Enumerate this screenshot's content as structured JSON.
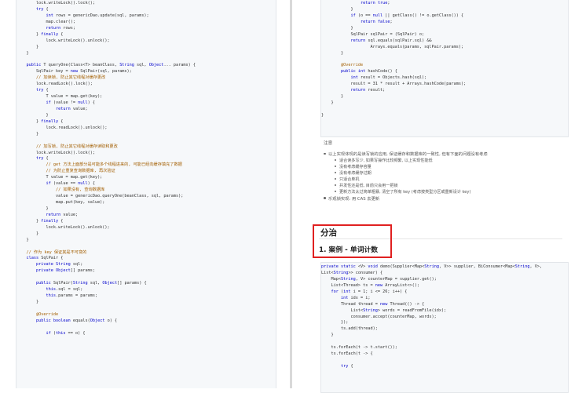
{
  "left_code": [
    [
      [
        "tx",
        "        lock.writeLock().lock();"
      ]
    ],
    [
      [
        "tx",
        "        "
      ],
      [
        "kw",
        "try"
      ],
      [
        "tx",
        " {"
      ]
    ],
    [
      [
        "tx",
        "            "
      ],
      [
        "kw",
        "int"
      ],
      [
        "tx",
        " rows = genericDao.update(sql, params);"
      ]
    ],
    [
      [
        "tx",
        "            map.clear();"
      ]
    ],
    [
      [
        "tx",
        "            "
      ],
      [
        "kw",
        "return"
      ],
      [
        "tx",
        " rows;"
      ]
    ],
    [
      [
        "tx",
        "        } "
      ],
      [
        "kw",
        "finally"
      ],
      [
        "tx",
        " {"
      ]
    ],
    [
      [
        "tx",
        "            lock.writeLock().unlock();"
      ]
    ],
    [
      [
        "tx",
        "        }"
      ]
    ],
    [
      [
        "tx",
        "    }"
      ]
    ],
    [
      [
        "tx",
        ""
      ]
    ],
    [
      [
        "kw",
        "    public"
      ],
      [
        "tx",
        " T queryOne(Class<T> beanClass, "
      ],
      [
        "kw",
        "String"
      ],
      [
        "tx",
        " sql, "
      ],
      [
        "kw",
        "Object"
      ],
      [
        "tx",
        "... params) {"
      ]
    ],
    [
      [
        "tx",
        "        SqlPair key = "
      ],
      [
        "kw",
        "new"
      ],
      [
        "tx",
        " SqlPair(sql, params);"
      ]
    ],
    [
      [
        "cm",
        "        // 加读锁, 防止其它线程对缓存更改"
      ]
    ],
    [
      [
        "tx",
        "        lock.readLock().lock();"
      ]
    ],
    [
      [
        "tx",
        "        "
      ],
      [
        "kw",
        "try"
      ],
      [
        "tx",
        " {"
      ]
    ],
    [
      [
        "tx",
        "            T value = map.get(key);"
      ]
    ],
    [
      [
        "tx",
        "            "
      ],
      [
        "kw",
        "if"
      ],
      [
        "tx",
        " (value != "
      ],
      [
        "kw",
        "null"
      ],
      [
        "tx",
        ") {"
      ]
    ],
    [
      [
        "tx",
        "                "
      ],
      [
        "kw",
        "return"
      ],
      [
        "tx",
        " value;"
      ]
    ],
    [
      [
        "tx",
        "            }"
      ]
    ],
    [
      [
        "tx",
        "        } "
      ],
      [
        "kw",
        "finally"
      ],
      [
        "tx",
        " {"
      ]
    ],
    [
      [
        "tx",
        "            lock.readLock().unlock();"
      ]
    ],
    [
      [
        "tx",
        "        }"
      ]
    ],
    [
      [
        "tx",
        ""
      ]
    ],
    [
      [
        "cm",
        "        // 加写锁, 防止其它线程对缓存读取和更改"
      ]
    ],
    [
      [
        "tx",
        "        lock.writeLock().lock();"
      ]
    ],
    [
      [
        "tx",
        "        "
      ],
      [
        "kw",
        "try"
      ],
      [
        "tx",
        " {"
      ]
    ],
    [
      [
        "cm",
        "            // get 方法上面部分是可能多个线程进来的, 可能已经向缓存填充了数据"
      ]
    ],
    [
      [
        "cm",
        "            // 为防止重复查询数据库, 再次验证"
      ]
    ],
    [
      [
        "tx",
        "            T value = map.get(key);"
      ]
    ],
    [
      [
        "tx",
        "            "
      ],
      [
        "kw",
        "if"
      ],
      [
        "tx",
        " (value == "
      ],
      [
        "kw",
        "null"
      ],
      [
        "tx",
        ") {"
      ]
    ],
    [
      [
        "cm",
        "                // 如果没有, 查询数据库"
      ]
    ],
    [
      [
        "tx",
        "                value = genericDao.queryOne(beanClass, sql, params);"
      ]
    ],
    [
      [
        "tx",
        "                map.put(key, value);"
      ]
    ],
    [
      [
        "tx",
        "            }"
      ]
    ],
    [
      [
        "tx",
        "            "
      ],
      [
        "kw",
        "return"
      ],
      [
        "tx",
        " value;"
      ]
    ],
    [
      [
        "tx",
        "        } "
      ],
      [
        "kw",
        "finally"
      ],
      [
        "tx",
        " {"
      ]
    ],
    [
      [
        "tx",
        "            lock.writeLock().unlock();"
      ]
    ],
    [
      [
        "tx",
        "        }"
      ]
    ],
    [
      [
        "tx",
        "    }"
      ]
    ],
    [
      [
        "tx",
        ""
      ]
    ],
    [
      [
        "cm",
        "    // 作为 key 保证其是不可变的"
      ]
    ],
    [
      [
        "kw",
        "    class"
      ],
      [
        "tx",
        " SqlPair {"
      ]
    ],
    [
      [
        "kw",
        "        private"
      ],
      [
        "tx",
        " "
      ],
      [
        "kw",
        "String"
      ],
      [
        "tx",
        " sql;"
      ]
    ],
    [
      [
        "kw",
        "        private"
      ],
      [
        "tx",
        " "
      ],
      [
        "kw",
        "Object"
      ],
      [
        "tx",
        "[] params;"
      ]
    ],
    [
      [
        "tx",
        ""
      ]
    ],
    [
      [
        "kw",
        "        public"
      ],
      [
        "tx",
        " SqlPair("
      ],
      [
        "kw",
        "String"
      ],
      [
        "tx",
        " sql, "
      ],
      [
        "kw",
        "Object"
      ],
      [
        "tx",
        "[] params) {"
      ]
    ],
    [
      [
        "kw",
        "            this"
      ],
      [
        "tx",
        ".sql = sql;"
      ]
    ],
    [
      [
        "kw",
        "            this"
      ],
      [
        "tx",
        ".params = params;"
      ]
    ],
    [
      [
        "tx",
        "        }"
      ]
    ],
    [
      [
        "tx",
        ""
      ]
    ],
    [
      [
        "cm",
        "        @Override"
      ]
    ],
    [
      [
        "kw",
        "        public boolean"
      ],
      [
        "tx",
        " equals("
      ],
      [
        "kw",
        "Object"
      ],
      [
        "tx",
        " o) {"
      ]
    ],
    [
      [
        "tx",
        ""
      ]
    ],
    [
      [
        "tx",
        "            "
      ],
      [
        "kw",
        "if"
      ],
      [
        "tx",
        " ("
      ],
      [
        "kw",
        "this"
      ],
      [
        "tx",
        " == o) {"
      ]
    ]
  ],
  "right_code_top": [
    [
      [
        "tx",
        "                "
      ],
      [
        "kw",
        "return true"
      ],
      [
        "tx",
        ";"
      ]
    ],
    [
      [
        "tx",
        "            }"
      ]
    ],
    [
      [
        "tx",
        "            "
      ],
      [
        "kw",
        "if"
      ],
      [
        "tx",
        " (o == "
      ],
      [
        "kw",
        "null"
      ],
      [
        "tx",
        " || getClass() != o.getClass()) {"
      ]
    ],
    [
      [
        "tx",
        "                "
      ],
      [
        "kw",
        "return false"
      ],
      [
        "tx",
        ";"
      ]
    ],
    [
      [
        "tx",
        "            }"
      ]
    ],
    [
      [
        "tx",
        "            SqlPair sqlPair = (SqlPair) o;"
      ]
    ],
    [
      [
        "tx",
        "            "
      ],
      [
        "kw",
        "return"
      ],
      [
        "tx",
        " sql.equals(sqlPair.sql) &&"
      ]
    ],
    [
      [
        "tx",
        "                    Arrays.equals(params, sqlPair.params);"
      ]
    ],
    [
      [
        "tx",
        "        }"
      ]
    ],
    [
      [
        "tx",
        ""
      ]
    ],
    [
      [
        "cm",
        "        @Override"
      ]
    ],
    [
      [
        "kw",
        "        public int"
      ],
      [
        "tx",
        " hashCode() {"
      ]
    ],
    [
      [
        "tx",
        "            "
      ],
      [
        "kw",
        "int"
      ],
      [
        "tx",
        " result = Objects.hash(sql);"
      ]
    ],
    [
      [
        "tx",
        "            result = 31 * result + Arrays.hashCode(params);"
      ]
    ],
    [
      [
        "tx",
        "            "
      ],
      [
        "kw",
        "return"
      ],
      [
        "tx",
        " result;"
      ]
    ],
    [
      [
        "tx",
        "        }"
      ]
    ],
    [
      [
        "tx",
        "    }"
      ]
    ],
    [
      [
        "tx",
        ""
      ]
    ],
    [
      [
        "tx",
        "}"
      ]
    ],
    [
      [
        "tx",
        ""
      ]
    ]
  ],
  "notes": {
    "title": "注意",
    "items": [
      {
        "level": 1,
        "text": "以上实现体现的是读写锁的应用, 保证缓存和数据库的一致性, 但有下面的问题没有考虑"
      },
      {
        "level": 2,
        "text": "适合读多写少, 如果写操作比较频繁, 以上实现性能低"
      },
      {
        "level": 2,
        "text": "没有考虑缓存容量"
      },
      {
        "level": 2,
        "text": "没有考虑缓存过期"
      },
      {
        "level": 2,
        "text": "只适合单机"
      },
      {
        "level": 2,
        "text": "并发性还是低, 目前只会用一把锁"
      },
      {
        "level": 2,
        "text": "更新方法太过简单粗暴, 清空了所有 key (考虑按类型分区或重新设计 key)"
      },
      {
        "level": 1,
        "text": "乐观锁实现: 用 CAS 去更新"
      }
    ]
  },
  "section": {
    "heading": "分治",
    "subheading": "1. 案例 - 单词计数"
  },
  "right_code_bottom": [
    [
      [
        "kw",
        "private static"
      ],
      [
        "tx",
        " <V> "
      ],
      [
        "kw",
        "void"
      ],
      [
        "tx",
        " demo(Supplier<Map<"
      ],
      [
        "kw",
        "String"
      ],
      [
        "tx",
        ", V>> supplier, BiConsumer<Map<"
      ],
      [
        "kw",
        "String"
      ],
      [
        "tx",
        ", V>,"
      ]
    ],
    [
      [
        "tx",
        "List<"
      ],
      [
        "kw",
        "String"
      ],
      [
        "tx",
        ">> consumer) {"
      ]
    ],
    [
      [
        "tx",
        "    Map<"
      ],
      [
        "kw",
        "String"
      ],
      [
        "tx",
        ", V> counterMap = supplier.get();"
      ]
    ],
    [
      [
        "tx",
        "    List<Thread> ts = "
      ],
      [
        "kw",
        "new"
      ],
      [
        "tx",
        " ArrayList<>();"
      ]
    ],
    [
      [
        "tx",
        "    "
      ],
      [
        "kw",
        "for"
      ],
      [
        "tx",
        " ("
      ],
      [
        "kw",
        "int"
      ],
      [
        "tx",
        " i = 1; i <= 26; i++) {"
      ]
    ],
    [
      [
        "tx",
        "        "
      ],
      [
        "kw",
        "int"
      ],
      [
        "tx",
        " idx = i;"
      ]
    ],
    [
      [
        "tx",
        "        Thread thread = "
      ],
      [
        "kw",
        "new"
      ],
      [
        "tx",
        " Thread(() -> {"
      ]
    ],
    [
      [
        "tx",
        "            List<"
      ],
      [
        "kw",
        "String"
      ],
      [
        "tx",
        "> words = readFromFile(idx);"
      ]
    ],
    [
      [
        "tx",
        "            consumer.accept(counterMap, words);"
      ]
    ],
    [
      [
        "tx",
        "        });"
      ]
    ],
    [
      [
        "tx",
        "        ts.add(thread);"
      ]
    ],
    [
      [
        "tx",
        "    }"
      ]
    ],
    [
      [
        "tx",
        ""
      ]
    ],
    [
      [
        "tx",
        "    ts.forEach(t -> t.start());"
      ]
    ],
    [
      [
        "tx",
        "    ts.forEach(t -> {"
      ]
    ],
    [
      [
        "tx",
        ""
      ]
    ],
    [
      [
        "tx",
        "        "
      ],
      [
        "kw",
        "try"
      ],
      [
        "tx",
        " {"
      ]
    ]
  ]
}
